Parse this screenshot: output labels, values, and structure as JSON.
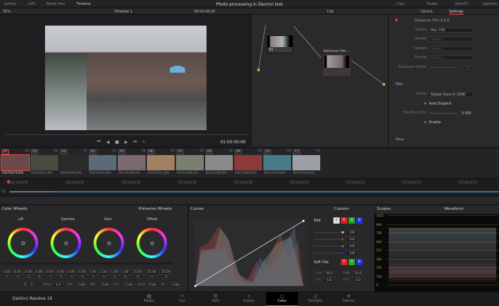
{
  "topbar": {
    "items": [
      "Gallery",
      "LUTs",
      "Media Pool",
      "Timeline"
    ],
    "title": "Photo processing in Davinci test",
    "right": [
      "Clips",
      "Nodes",
      "OpenFX",
      "Lightbox"
    ]
  },
  "subbar": {
    "zoom": "35%",
    "timeline": "Timeline 1",
    "timecode": "00:00:00:00",
    "clip_mode": "Clip",
    "tabs": [
      "Library",
      "Settings"
    ]
  },
  "viewer": {
    "timecode": "01:00:00:00"
  },
  "nodes": [
    {
      "label": "01"
    },
    {
      "label": "Dehancer Film ..."
    }
  ],
  "settings": {
    "plugin": "Dehancer Film 0.8.6",
    "rows": [
      {
        "label": "Source",
        "value": "Rec.709"
      },
      {
        "label": "Vendor",
        "value": "Select..."
      },
      {
        "label": "Camera",
        "value": "Select..."
      },
      {
        "label": "Format",
        "value": "Select..."
      },
      {
        "label": "Exposure Comp.",
        "value": "0.000"
      }
    ],
    "film_section": "Film",
    "profile_label": "Profile",
    "profile": "Kodak Vision3 250D",
    "auto_expand": "Auto Expand",
    "pull_push_label": "Pull/Push (Ev)",
    "pull_push": "0.000",
    "enable": "Enable",
    "print_section": "Print"
  },
  "clips": [
    {
      "num": "01",
      "track": "V1",
      "name": "DSCF6479.JPG"
    },
    {
      "num": "02",
      "track": "V1",
      "name": "DSCF6503.JPG"
    },
    {
      "num": "03",
      "track": "V1",
      "name": "DSCF6496.JPG"
    },
    {
      "num": "04",
      "track": "V1",
      "name": "DSCF6381.JPG"
    },
    {
      "num": "05",
      "track": "V1",
      "name": "DSCF6198.JPG"
    },
    {
      "num": "06",
      "track": "V1",
      "name": "DSCF6521.JPG"
    },
    {
      "num": "07",
      "track": "V1",
      "name": "DSCF6498.JPG"
    },
    {
      "num": "08",
      "track": "V1",
      "name": "DSCF6490.JPG"
    },
    {
      "num": "09",
      "track": "V1",
      "name": "DSCF6286.JPG"
    },
    {
      "num": "10",
      "track": "V1",
      "name": "DSCF5729.JPG"
    },
    {
      "num": "11",
      "track": "V1",
      "name": "DSCF5449.JPG"
    }
  ],
  "timeline": {
    "track": "V1",
    "ticks": [
      "01:00:00:00",
      "01:00:00:02",
      "01:00:00:04",
      "01:00:00:06",
      "01:00:00:08",
      "01:00:00:10",
      "01:00:00:12",
      "01:00:00:14",
      "01:00:00:16"
    ]
  },
  "color_wheels": {
    "title": "Color Wheels",
    "mode": "Primaries Wheels",
    "wheels": [
      {
        "name": "Lift",
        "values": [
          "0.00",
          "0.00",
          "0.00",
          "0.00"
        ],
        "channels": [
          "Y",
          "R",
          "G",
          "B"
        ]
      },
      {
        "name": "Gamma",
        "values": [
          "0.00",
          "0.00",
          "0.00",
          "0.00"
        ],
        "channels": [
          "Y",
          "R",
          "G",
          "B"
        ]
      },
      {
        "name": "Gain",
        "values": [
          "1.00",
          "1.00",
          "1.00",
          "1.00"
        ],
        "channels": [
          "Y",
          "R",
          "G",
          "B"
        ]
      },
      {
        "name": "Offset",
        "values": [
          "25.00",
          "25.00",
          "25.00"
        ],
        "channels": [
          "R",
          "G",
          "B"
        ]
      }
    ],
    "page1": "1",
    "page2": "2",
    "adjust": [
      {
        "label": "Temp",
        "value": "0.0"
      },
      {
        "label": "Tint",
        "value": "0.00"
      },
      {
        "label": "MD",
        "value": "0.00"
      },
      {
        "label": "Col",
        "value": "0.00"
      },
      {
        "label": "Shad",
        "value": "0.00"
      },
      {
        "label": "HL",
        "value": "0.00"
      }
    ]
  },
  "curves": {
    "title": "Curves",
    "mode": "Custom",
    "edit_label": "Edit",
    "channels": [
      "Y",
      "R",
      "G",
      "B"
    ],
    "intensity": [
      "100",
      "100",
      "100",
      "100"
    ],
    "soft_clip": "Soft Clip",
    "low_label": "Low",
    "low": "50.0",
    "high_label": "High",
    "high": "50.0",
    "ls_label": "L.S.",
    "ls": "0.0",
    "hs_label": "H.S.",
    "hs": "0.0"
  },
  "scopes": {
    "title": "Scopes",
    "mode": "Waveform",
    "scale": [
      "1023",
      "896",
      "768",
      "640",
      "512",
      "384",
      "256",
      "128",
      "0"
    ]
  },
  "app": {
    "name": "DaVinci Resolve 16"
  },
  "pages": [
    "Media",
    "Cut",
    "Edit",
    "Fusion",
    "Color",
    "Fairlight",
    "Deliver"
  ],
  "colors": {
    "accent": "#e64b3c",
    "scope_label": "#c8a24a"
  }
}
